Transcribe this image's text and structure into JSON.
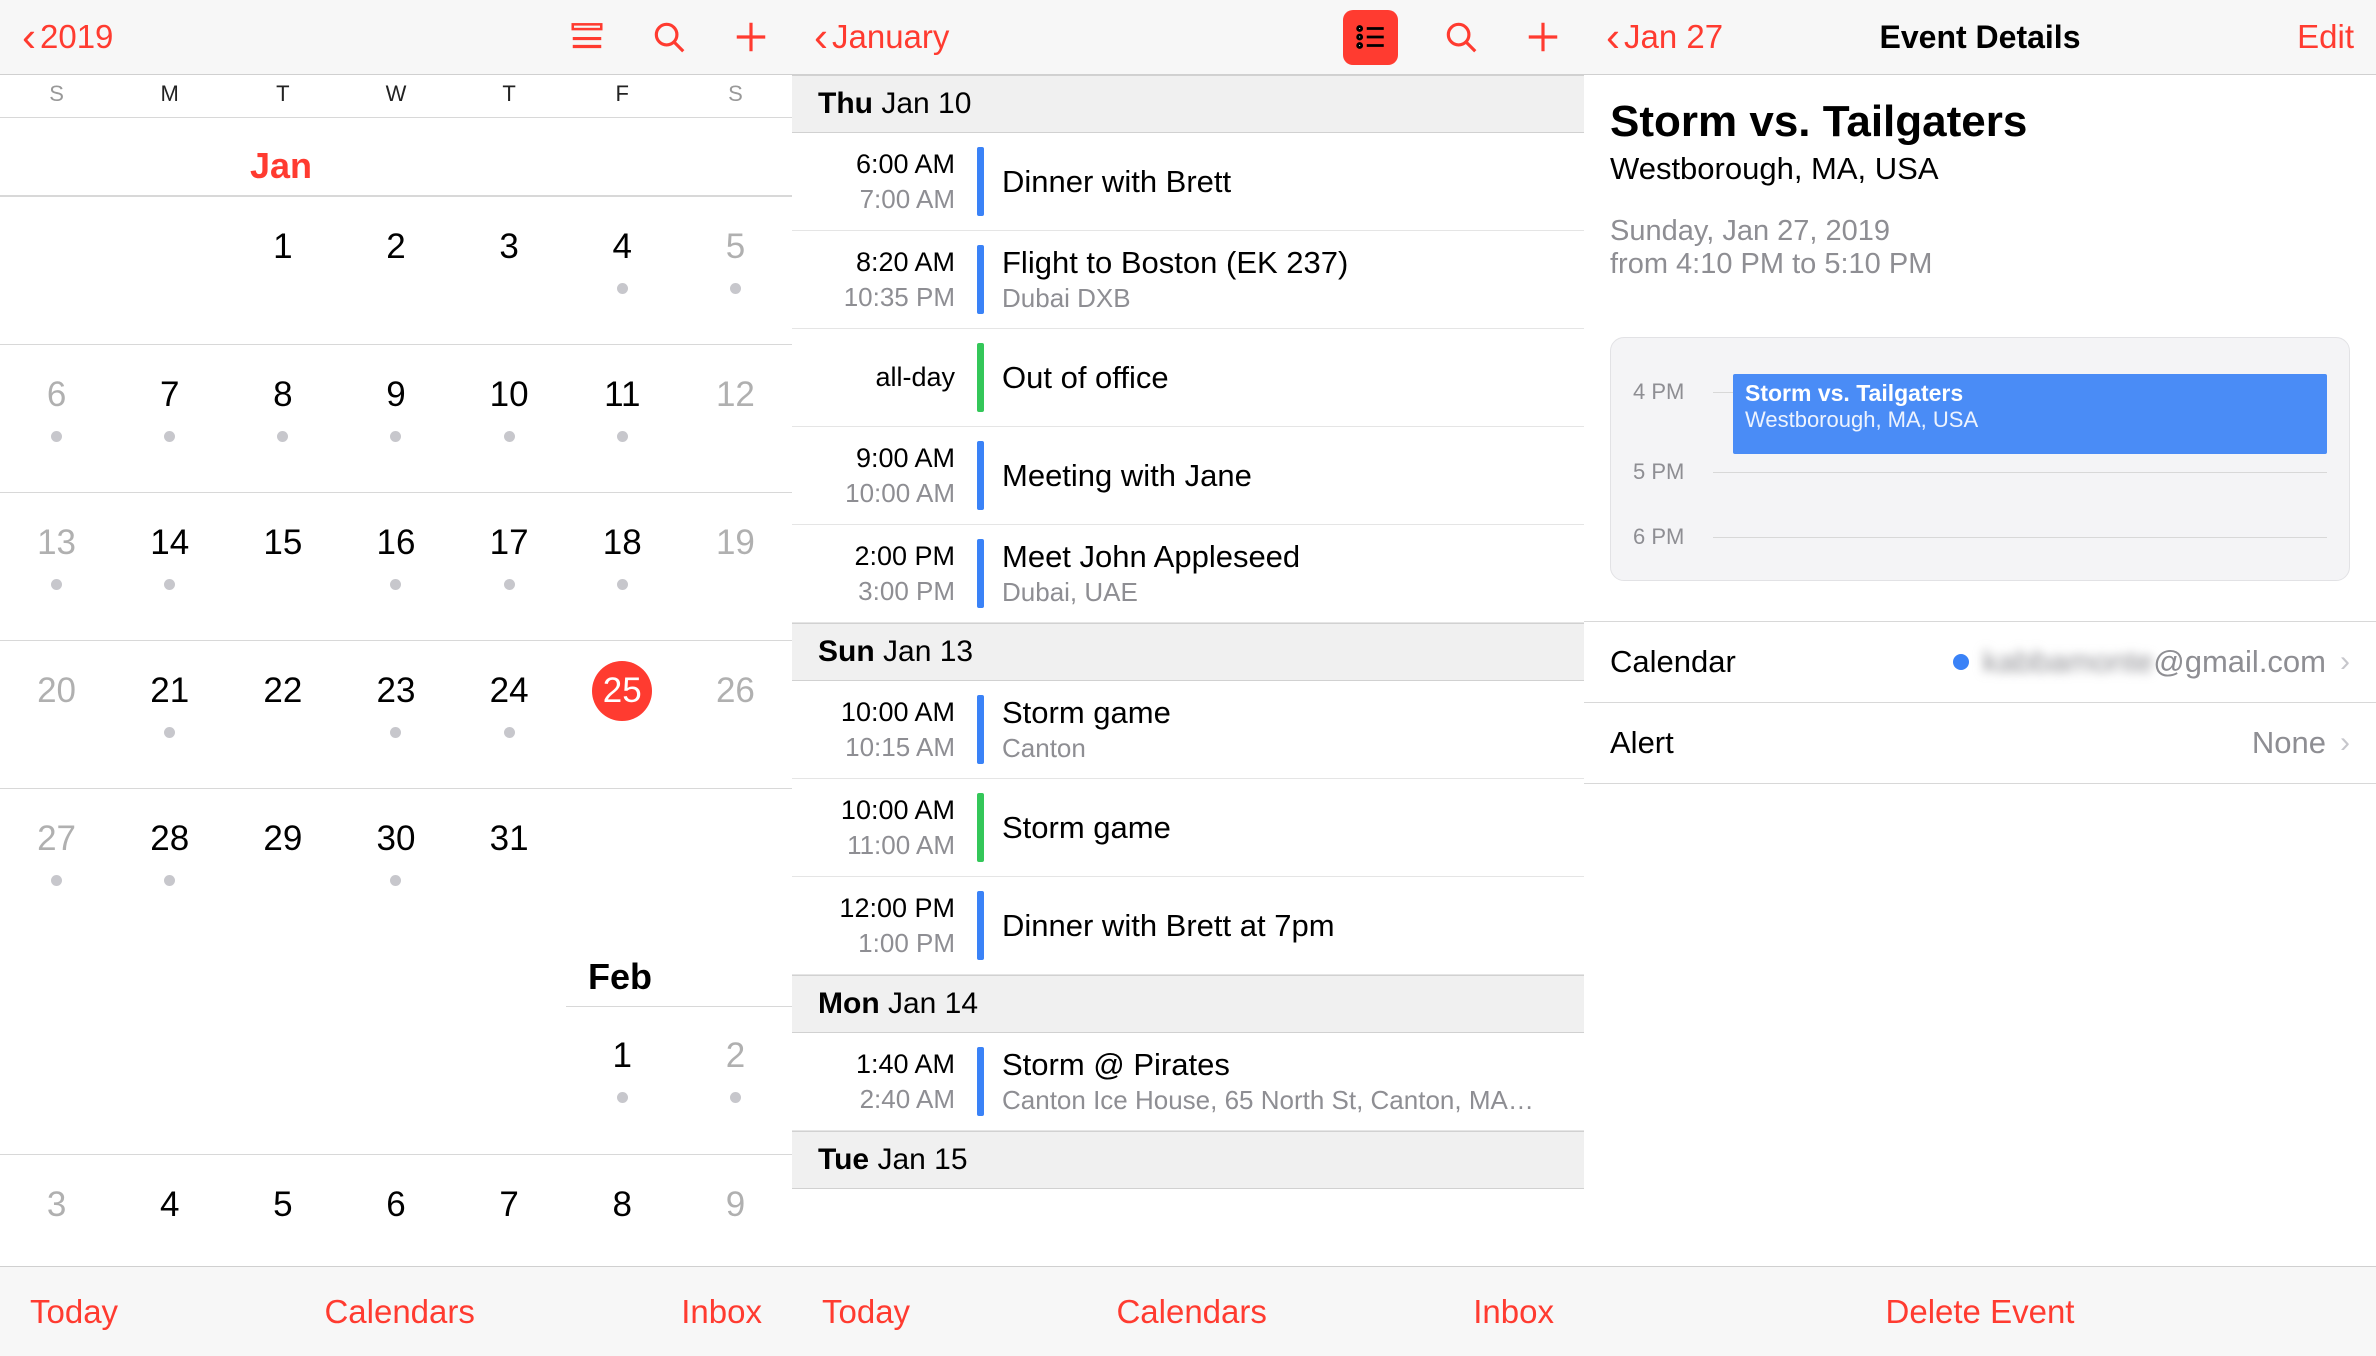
{
  "pane1": {
    "back_label": "2019",
    "month_label_1": "Jan",
    "month_label_2": "Feb",
    "weekdays": [
      "S",
      "M",
      "T",
      "W",
      "T",
      "F",
      "S"
    ],
    "tab_today": "Today",
    "tab_calendars": "Calendars",
    "tab_inbox": "Inbox",
    "rows": [
      {
        "days": [
          {
            "n": "",
            "dot": false
          },
          {
            "n": "",
            "dot": false
          },
          {
            "n": "1",
            "dot": false
          },
          {
            "n": "2",
            "dot": false
          },
          {
            "n": "3",
            "dot": false
          },
          {
            "n": "4",
            "dot": true
          },
          {
            "n": "5",
            "dot": true,
            "dim": true
          }
        ]
      },
      {
        "days": [
          {
            "n": "6",
            "dot": true,
            "dim": true
          },
          {
            "n": "7",
            "dot": true
          },
          {
            "n": "8",
            "dot": true
          },
          {
            "n": "9",
            "dot": true
          },
          {
            "n": "10",
            "dot": true
          },
          {
            "n": "11",
            "dot": true
          },
          {
            "n": "12",
            "dot": false,
            "dim": true
          }
        ]
      },
      {
        "days": [
          {
            "n": "13",
            "dot": true,
            "dim": true
          },
          {
            "n": "14",
            "dot": true
          },
          {
            "n": "15",
            "dot": false
          },
          {
            "n": "16",
            "dot": true
          },
          {
            "n": "17",
            "dot": true
          },
          {
            "n": "18",
            "dot": true
          },
          {
            "n": "19",
            "dot": false,
            "dim": true
          }
        ]
      },
      {
        "days": [
          {
            "n": "20",
            "dot": false,
            "dim": true
          },
          {
            "n": "21",
            "dot": true
          },
          {
            "n": "22",
            "dot": false
          },
          {
            "n": "23",
            "dot": true
          },
          {
            "n": "24",
            "dot": true
          },
          {
            "n": "25",
            "dot": false,
            "sel": true
          },
          {
            "n": "26",
            "dot": false,
            "dim": true
          }
        ]
      },
      {
        "days": [
          {
            "n": "27",
            "dot": true,
            "dim": true
          },
          {
            "n": "28",
            "dot": true
          },
          {
            "n": "29",
            "dot": false
          },
          {
            "n": "30",
            "dot": true
          },
          {
            "n": "31",
            "dot": false
          },
          {
            "n": "",
            "dot": false
          },
          {
            "n": "",
            "dot": false
          }
        ]
      }
    ],
    "feb_row": {
      "days": [
        {
          "n": "",
          "dot": false
        },
        {
          "n": "",
          "dot": false
        },
        {
          "n": "",
          "dot": false
        },
        {
          "n": "",
          "dot": false
        },
        {
          "n": "",
          "dot": false
        },
        {
          "n": "1",
          "dot": true
        },
        {
          "n": "2",
          "dot": true,
          "dim": true
        }
      ]
    },
    "feb_row2": {
      "days": [
        {
          "n": "3",
          "dim": true
        },
        {
          "n": "4"
        },
        {
          "n": "5"
        },
        {
          "n": "6"
        },
        {
          "n": "7"
        },
        {
          "n": "8"
        },
        {
          "n": "9",
          "dim": true
        }
      ]
    }
  },
  "pane2": {
    "back_label": "January",
    "tab_today": "Today",
    "tab_calendars": "Calendars",
    "tab_inbox": "Inbox",
    "groups": [
      {
        "header_day": "Thu",
        "header_date": "  Jan 10",
        "events": [
          {
            "t1": "6:00 AM",
            "t2": "7:00 AM",
            "bar": "blue",
            "title": "Dinner with Brett",
            "sub": ""
          },
          {
            "t1": "8:20 AM",
            "t2": "10:35 PM",
            "bar": "blue",
            "title": "Flight to Boston (EK 237)",
            "sub": "Dubai DXB"
          },
          {
            "allday": "all-day",
            "bar": "green",
            "title": "Out of office",
            "sub": ""
          },
          {
            "t1": "9:00 AM",
            "t2": "10:00 AM",
            "bar": "blue",
            "title": "Meeting with Jane",
            "sub": ""
          },
          {
            "t1": "2:00 PM",
            "t2": "3:00 PM",
            "bar": "blue",
            "title": "Meet John Appleseed",
            "sub": "Dubai, UAE"
          }
        ]
      },
      {
        "header_day": "Sun",
        "header_date": "  Jan 13",
        "events": [
          {
            "t1": "10:00 AM",
            "t2": "10:15 AM",
            "bar": "blue",
            "title": "Storm game",
            "sub": "Canton"
          },
          {
            "t1": "10:00 AM",
            "t2": "11:00 AM",
            "bar": "green",
            "title": "Storm game",
            "sub": ""
          },
          {
            "t1": "12:00 PM",
            "t2": "1:00 PM",
            "bar": "blue",
            "title": "Dinner with Brett at 7pm",
            "sub": ""
          }
        ]
      },
      {
        "header_day": "Mon",
        "header_date": "  Jan 14",
        "events": [
          {
            "t1": "1:40 AM",
            "t2": "2:40 AM",
            "bar": "blue",
            "title": "Storm @ Pirates",
            "sub": "Canton Ice House, 65 North St, Canton, MA…"
          }
        ]
      },
      {
        "header_day": "Tue",
        "header_date": "  Jan 15",
        "events": []
      }
    ]
  },
  "pane3": {
    "back_label": "Jan 27",
    "page_title": "Event Details",
    "edit": "Edit",
    "ev_title": "Storm vs. Tailgaters",
    "ev_loc": "Westborough, MA, USA",
    "ev_date": "Sunday, Jan 27, 2019",
    "ev_time": "from 4:10 PM to 5:10 PM",
    "preview_hours": [
      "4 PM",
      "5 PM",
      "6 PM"
    ],
    "preview_ev_title": "Storm vs. Tailgaters",
    "preview_ev_loc": "Westborough, MA, USA",
    "row_calendar_label": "Calendar",
    "row_calendar_email_obscured": "kabbamonte",
    "row_calendar_email_domain": "@gmail.com",
    "row_alert_label": "Alert",
    "row_alert_value": "None",
    "delete_label": "Delete Event"
  }
}
